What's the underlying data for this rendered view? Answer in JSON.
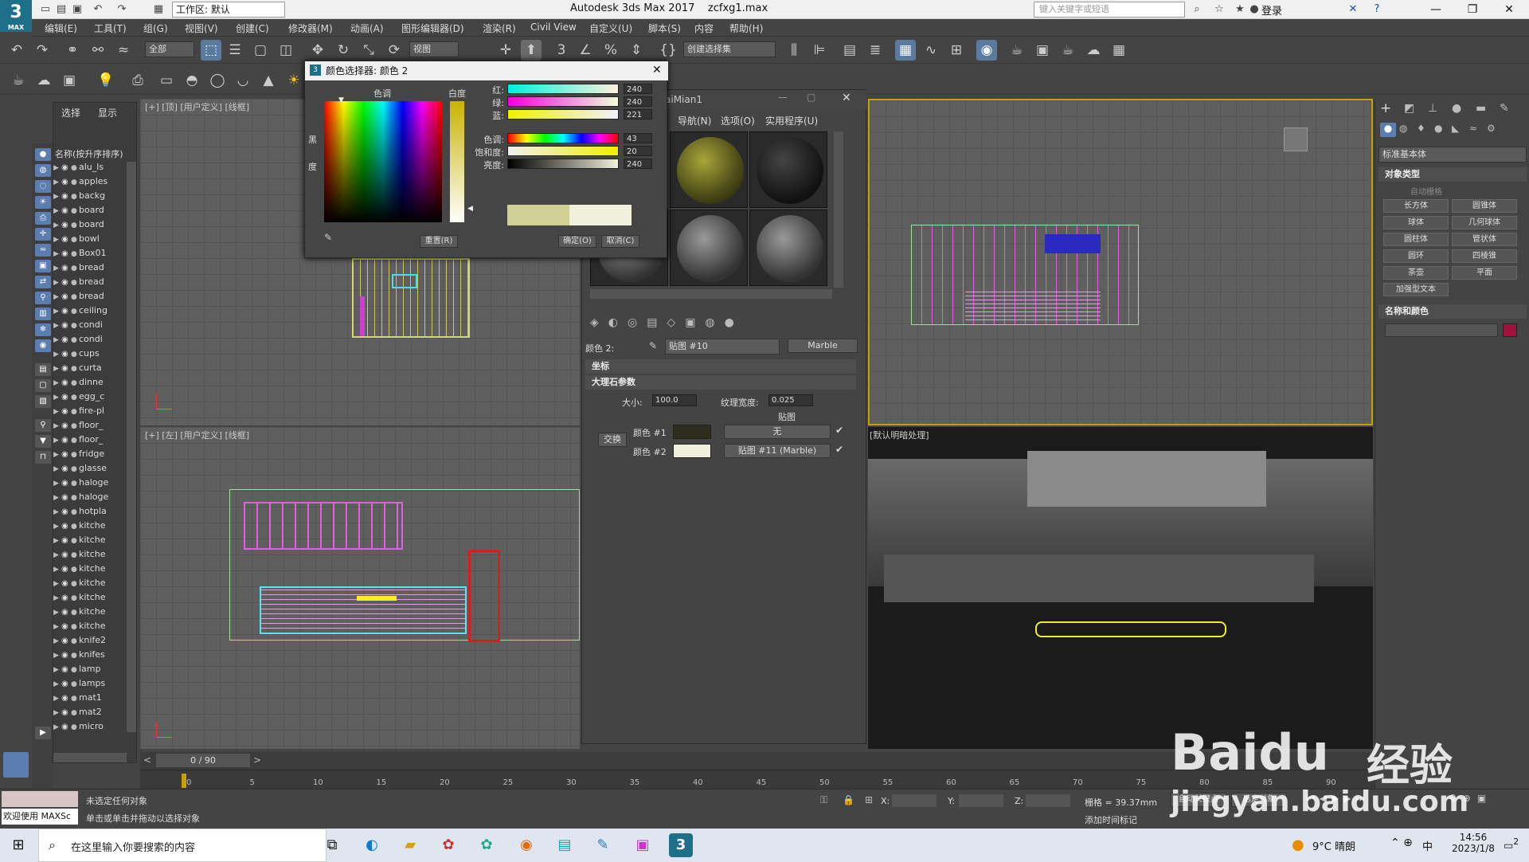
{
  "app": {
    "logo": "3",
    "logo_sub": "MAX",
    "title": "Autodesk 3ds Max 2017",
    "file": "zcfxg1.max",
    "workspace": "工作区: 默认",
    "search_placeholder": "键入关键字或短语",
    "login": "登录"
  },
  "menu": [
    "编辑(E)",
    "工具(T)",
    "组(G)",
    "视图(V)",
    "创建(C)",
    "修改器(M)",
    "动画(A)",
    "图形编辑器(D)",
    "渲染(R)",
    "Civil View",
    "自定义(U)",
    "脚本(S)",
    "内容",
    "帮助(H)"
  ],
  "toolbar": {
    "filter": "全部",
    "refcoord": "视图",
    "selset": "创建选择集"
  },
  "scene": {
    "tabs": [
      "选择",
      "显示"
    ],
    "header": "名称(按升序排序)",
    "items": [
      "alu_ls",
      "apples",
      "backg",
      "board",
      "board",
      "bowl",
      "Box01",
      "bread",
      "bread",
      "bread",
      "ceiling",
      "condi",
      "condi",
      "cups",
      "curta",
      "dinne",
      "egg_c",
      "fire-pl",
      "floor_",
      "floor_",
      "fridge",
      "glasse",
      "haloge",
      "haloge",
      "hotpla",
      "kitche",
      "kitche",
      "kitche",
      "kitche",
      "kitche",
      "kitche",
      "kitche",
      "kitche",
      "knife2",
      "knifes",
      "lamp",
      "lamps",
      "mat1",
      "mat2",
      "micro"
    ]
  },
  "viewports": {
    "top": "[+] [顶] [用户定义] [线框]",
    "left": "[+] [左] [用户定义] [线框]",
    "persp": "[默认明暗处理]"
  },
  "color_dialog": {
    "title": "颜色选择器: 颜色 2",
    "hue_label": "色调",
    "white_label": "白度",
    "black_label": "黑",
    "degree_label": "度",
    "rows": [
      {
        "label": "红:",
        "value": "240"
      },
      {
        "label": "绿:",
        "value": "240"
      },
      {
        "label": "蓝:",
        "value": "221"
      },
      {
        "label": "色调:",
        "value": "43"
      },
      {
        "label": "饱和度:",
        "value": "20"
      },
      {
        "label": "亮度:",
        "value": "240"
      }
    ],
    "reset": "重置(R)",
    "ok": "确定(O)",
    "cancel": "取消(C)",
    "swatch_color": "#f0f0dd"
  },
  "material_editor": {
    "title": "aiMian1",
    "menu": [
      "导航(N)",
      "选项(O)",
      "实用程序(U)"
    ],
    "color_label": "颜色 2:",
    "map_name": "贴图 #10",
    "map_type": "Marble",
    "rollout_coords": "坐标",
    "rollout_marble": "大理石参数",
    "size_label": "大小:",
    "size_value": "100.0",
    "vein_label": "纹理宽度:",
    "vein_value": "0.025",
    "maps_label": "贴图",
    "swap": "交换",
    "color1_label": "颜色 #1",
    "color2_label": "颜色 #2",
    "map1": "无",
    "map2": "贴图 #11 (Marble)",
    "color1": "#2e2d1e",
    "color2": "#f0f0dd"
  },
  "command_panel": {
    "dropdown": "标准基本体",
    "object_type": "对象类型",
    "autogrid": "自动栅格",
    "buttons": [
      "长方体",
      "圆锥体",
      "球体",
      "几何球体",
      "圆柱体",
      "管状体",
      "圆环",
      "四棱锥",
      "茶壶",
      "平面",
      "加强型文本"
    ],
    "name_color": "名称和颜色",
    "object_color": "#a0123e"
  },
  "timeline": {
    "frame": "0 / 90",
    "ticks": [
      "0",
      "5",
      "10",
      "15",
      "20",
      "25",
      "30",
      "35",
      "40",
      "45",
      "50",
      "55",
      "60",
      "65",
      "70",
      "75",
      "80",
      "85",
      "90"
    ]
  },
  "status": {
    "maxscript": "欢迎使用 MAXSc",
    "line1": "未选定任何对象",
    "line2": "单击或单击并拖动以选择对象",
    "x_label": "X:",
    "y_label": "Y:",
    "z_label": "Z:",
    "grid": "栅格 = 39.37mm",
    "add_time_tag": "添加时间标记",
    "autokey": "自动关键点",
    "selected": "选定对象"
  },
  "taskbar": {
    "search_placeholder": "在这里输入你要搜索的内容",
    "weather": "9°C 晴朗",
    "ime": "中",
    "time": "14:56",
    "date": "2023/1/8",
    "notif": "2"
  },
  "watermark": {
    "brand": "Baidu",
    "cn": "经验",
    "url": "jingyan.baidu.com"
  }
}
